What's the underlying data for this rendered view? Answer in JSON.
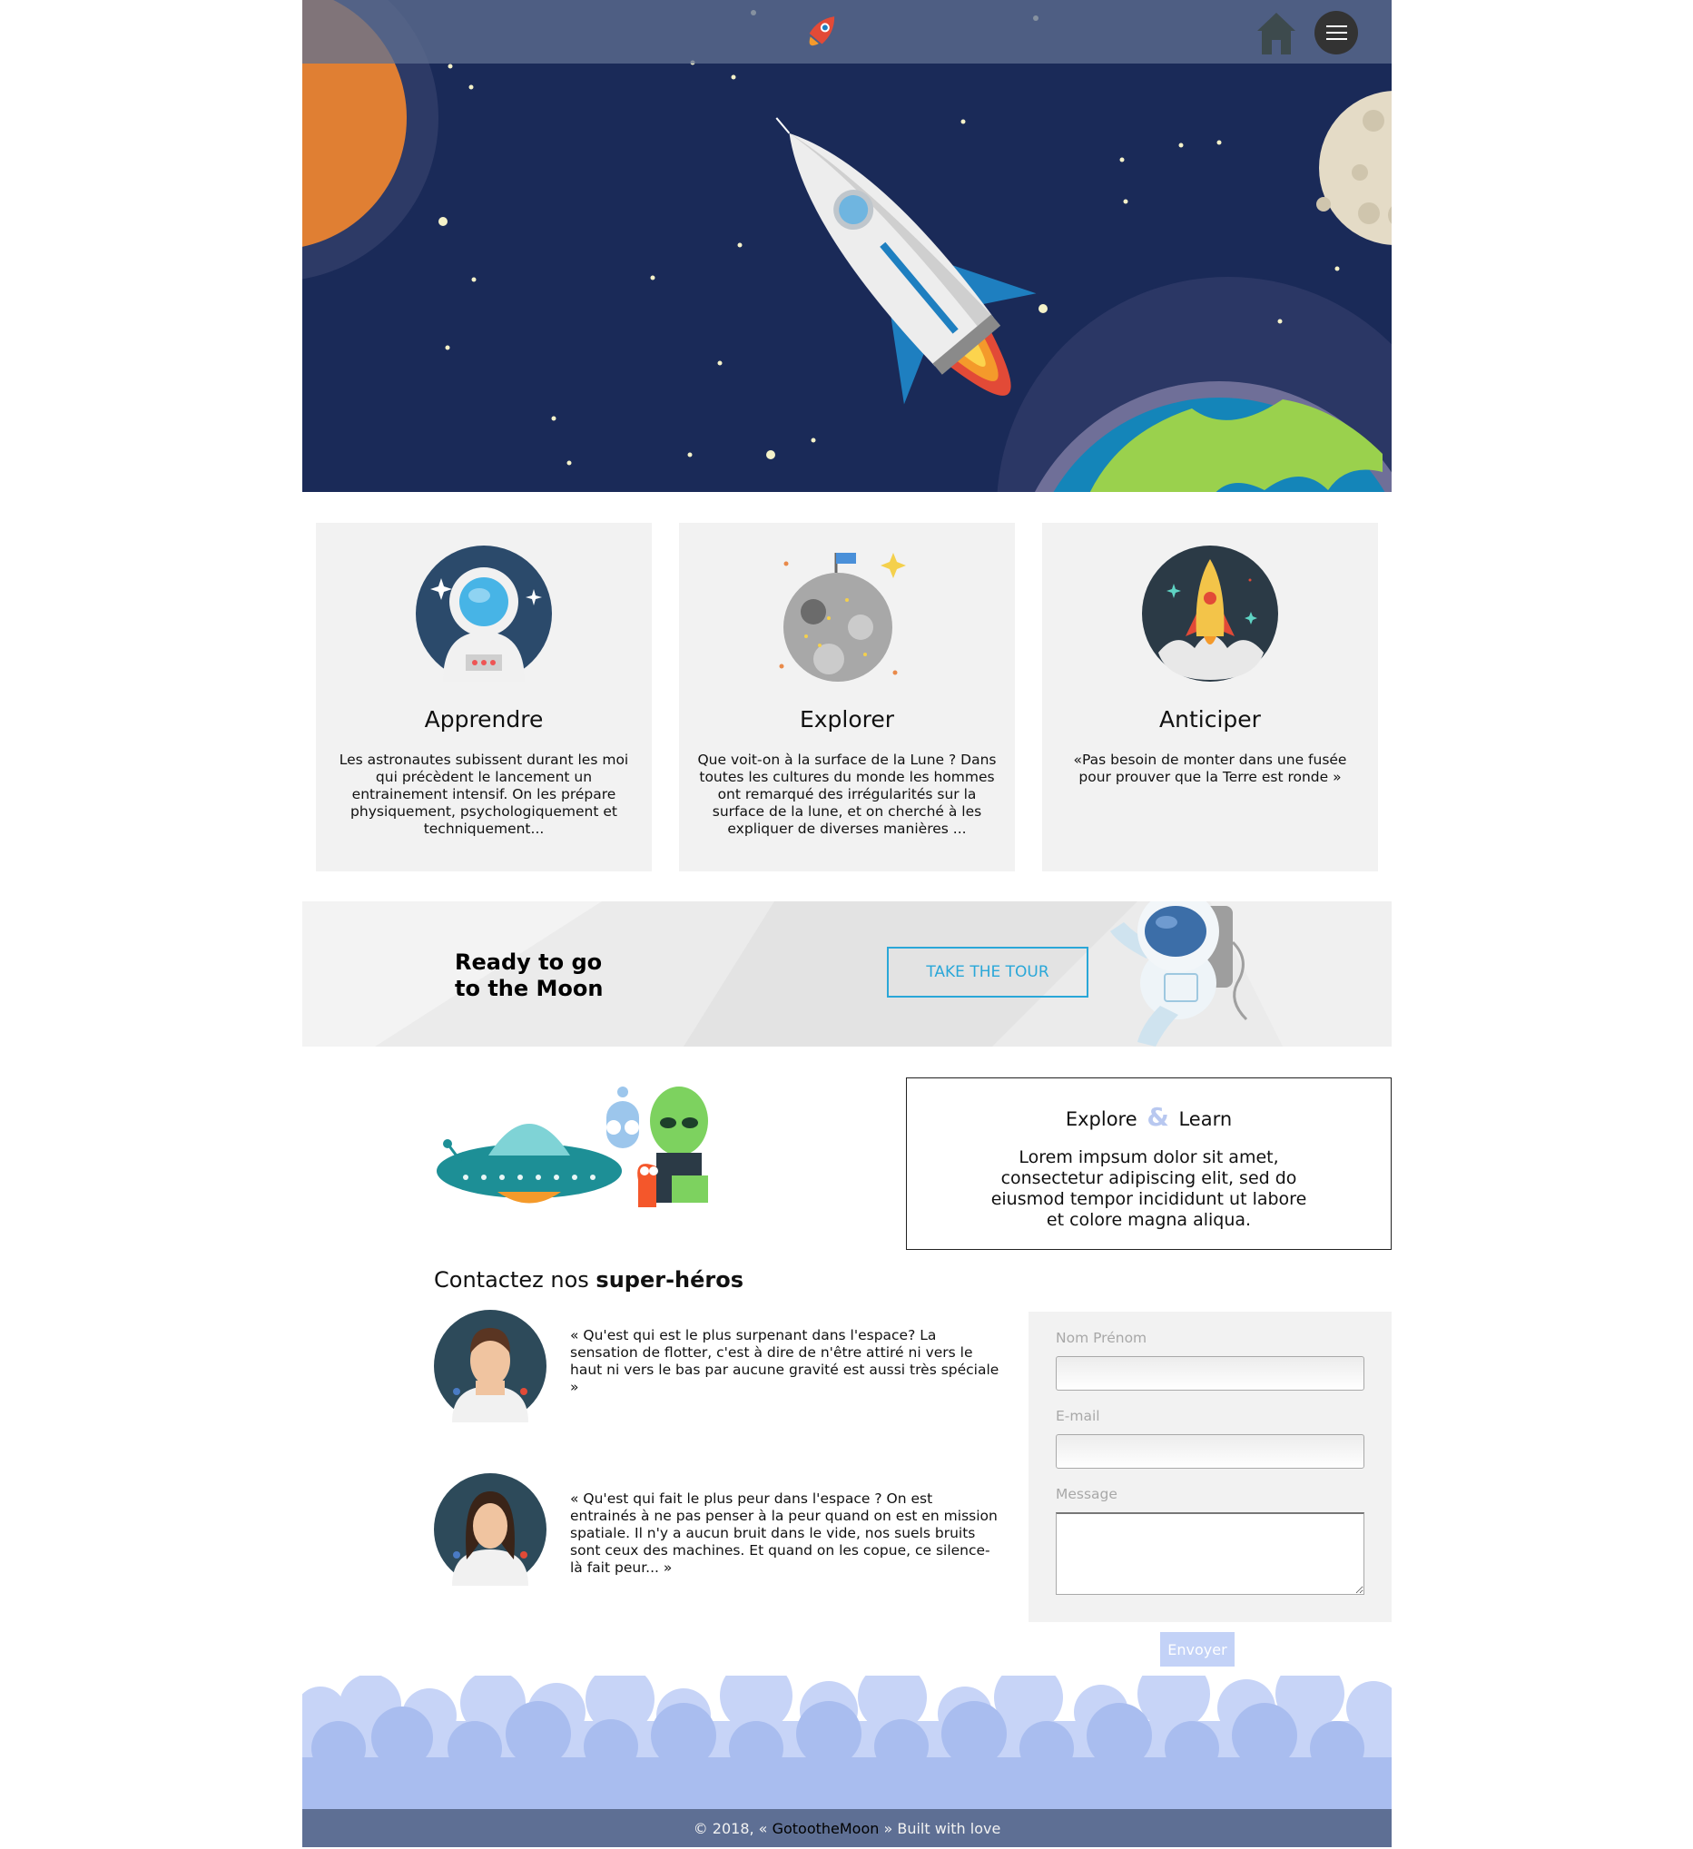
{
  "nav": {
    "home_icon": "home-icon",
    "menu_icon": "hamburger-menu-icon",
    "logo_icon": "rocket-logo-icon"
  },
  "features": [
    {
      "icon": "astronaut-icon",
      "title": "Apprendre",
      "text": "Les astronautes subissent durant les moi qui précèdent le lancement un entrainement intensif. On les prépare physiquement, psychologiquement et techniquement..."
    },
    {
      "icon": "moon-flag-icon",
      "title": "Explorer",
      "text": "Que voit-on à la surface de la Lune ? Dans toutes les cultures du monde les hommes ont remarqué des irrégularités sur la surface de la lune, et on cherché à les expliquer de diverses manières ..."
    },
    {
      "icon": "rocket-launch-icon",
      "title": "Anticiper",
      "text": "«Pas besoin de monter dans une fusée pour prouver que la Terre est ronde »"
    }
  ],
  "banner": {
    "title": "Ready to go\nto the Moon",
    "button": "TAKE THE TOUR"
  },
  "explore": {
    "title_left": "Explore",
    "amp": "&",
    "title_right": "Learn",
    "text": "Lorem impsum dolor sit amet, consectetur adipiscing elit, sed do eiusmod tempor incididunt ut labore et colore magna aliqua."
  },
  "contact": {
    "heading_plain": "Contactez nos ",
    "heading_bold": "super-héros",
    "quotes": [
      "« Qu'est qui est le plus surpenant dans l'espace? La sensation de flotter, c'est à dire de n'être attiré ni vers le haut ni vers le bas par aucune gravité est aussi très spéciale »",
      "« Qu'est qui fait le plus peur dans l'espace ? On est entrainés à ne pas penser à la peur quand on est en mission spatiale. Il n'y a aucun bruit dans le vide, nos suels bruits sont ceux des machines. Et quand on les copue, ce silence-là fait peur... »"
    ]
  },
  "form": {
    "name_label": "Nom Prénom",
    "email_label": "E-mail",
    "message_label": "Message",
    "submit": "Envoyer"
  },
  "footer": {
    "prefix": "© 2018, « ",
    "brand": "GotootheMoon",
    "suffix": " » Built with love"
  },
  "colors": {
    "space": "#1a2a58",
    "accent": "#2aa7d8",
    "footer": "#5e6f94",
    "cloud": "#a9bdef",
    "button_light": "#c3d2f7"
  }
}
